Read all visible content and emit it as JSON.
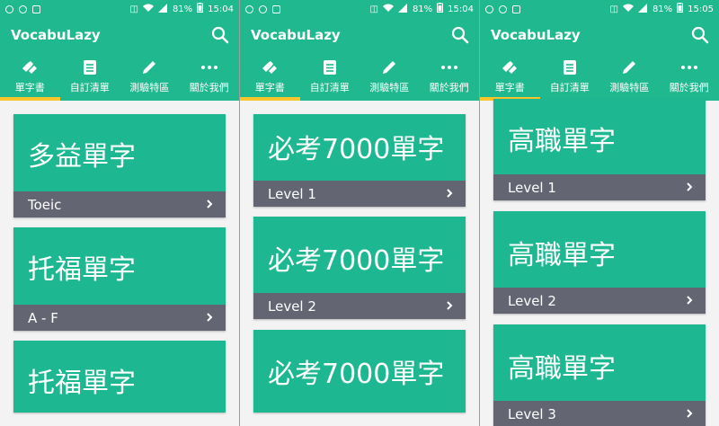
{
  "phones": [
    {
      "status": {
        "battery": "81%",
        "time": "15:04"
      },
      "app_title": "VocabuLazy",
      "tabs": [
        {
          "label": "單字書",
          "icon": "books-icon"
        },
        {
          "label": "自訂清單",
          "icon": "list-icon"
        },
        {
          "label": "測驗特區",
          "icon": "pencil-icon"
        },
        {
          "label": "關於我們",
          "icon": "more-icon"
        }
      ],
      "cards": [
        {
          "title": "多益單字",
          "subtitle": "Toeic"
        },
        {
          "title": "托福單字",
          "subtitle": "A - F"
        },
        {
          "title": "托福單字",
          "subtitle": ""
        }
      ]
    },
    {
      "status": {
        "battery": "81%",
        "time": "15:04"
      },
      "app_title": "VocabuLazy",
      "tabs": [
        {
          "label": "單字書",
          "icon": "books-icon"
        },
        {
          "label": "自訂清單",
          "icon": "list-icon"
        },
        {
          "label": "測驗特區",
          "icon": "pencil-icon"
        },
        {
          "label": "關於我們",
          "icon": "more-icon"
        }
      ],
      "cards": [
        {
          "title": "必考7000單字",
          "subtitle": "Level 1"
        },
        {
          "title": "必考7000單字",
          "subtitle": "Level 2"
        },
        {
          "title": "必考7000單字",
          "subtitle": ""
        }
      ]
    },
    {
      "status": {
        "battery": "81%",
        "time": "15:05"
      },
      "app_title": "VocabuLazy",
      "tabs": [
        {
          "label": "單字書",
          "icon": "books-icon"
        },
        {
          "label": "自訂清單",
          "icon": "list-icon"
        },
        {
          "label": "測驗特區",
          "icon": "pencil-icon"
        },
        {
          "label": "關於我們",
          "icon": "more-icon"
        }
      ],
      "cards": [
        {
          "title": "高職單字",
          "subtitle": "Level 1"
        },
        {
          "title": "高職單字",
          "subtitle": "Level 2"
        },
        {
          "title": "高職單字",
          "subtitle": "Level 3"
        }
      ]
    }
  ],
  "colors": {
    "primary": "#20b88e",
    "card": "#1db891",
    "footer": "#636672",
    "tab_indicator": "#f8c62b"
  }
}
